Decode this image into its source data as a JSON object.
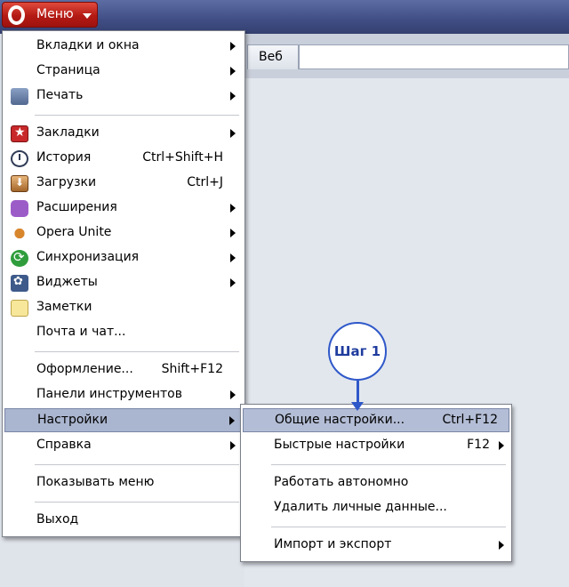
{
  "opera_button": {
    "label": "Меню"
  },
  "tab": {
    "label": "Веб"
  },
  "main_menu": [
    {
      "label": "Вкладки и окна",
      "submenu": true
    },
    {
      "label": "Страница",
      "submenu": true
    },
    {
      "label": "Печать",
      "submenu": true,
      "icon": "printer-icon"
    },
    {
      "label": "Закладки",
      "submenu": true,
      "icon": "bookmark-icon"
    },
    {
      "label": "История",
      "shortcut": "Ctrl+Shift+H",
      "icon": "history-icon"
    },
    {
      "label": "Загрузки",
      "shortcut": "Ctrl+J",
      "icon": "download-icon"
    },
    {
      "label": "Расширения",
      "submenu": true,
      "icon": "extensions-icon"
    },
    {
      "label": "Opera Unite",
      "submenu": true,
      "icon": "unite-icon"
    },
    {
      "label": "Синхронизация",
      "submenu": true,
      "icon": "sync-icon"
    },
    {
      "label": "Виджеты",
      "submenu": true,
      "icon": "widgets-icon"
    },
    {
      "label": "Заметки",
      "icon": "notes-icon"
    },
    {
      "label": "Почта и чат..."
    },
    {
      "label": "Оформление...",
      "shortcut": "Shift+F12"
    },
    {
      "label": "Панели инструментов",
      "submenu": true
    },
    {
      "label": "Настройки",
      "submenu": true,
      "highlighted": true
    },
    {
      "label": "Справка",
      "submenu": true
    },
    {
      "label": "Показывать меню"
    },
    {
      "label": "Выход"
    }
  ],
  "settings_submenu": [
    {
      "label": "Общие настройки...",
      "shortcut": "Ctrl+F12",
      "highlighted": true
    },
    {
      "label": "Быстрые настройки",
      "shortcut": "F12",
      "submenu": true
    },
    {
      "label": "Работать автономно"
    },
    {
      "label": "Удалить личные данные..."
    },
    {
      "label": "Импорт и экспорт",
      "submenu": true
    }
  ],
  "callout": {
    "label": "Шаг 1"
  },
  "colors": {
    "title_bar": "#3f4d84",
    "opera_red": "#b41a14",
    "highlight": "#aab5cf",
    "callout_blue": "#2f58c9"
  }
}
